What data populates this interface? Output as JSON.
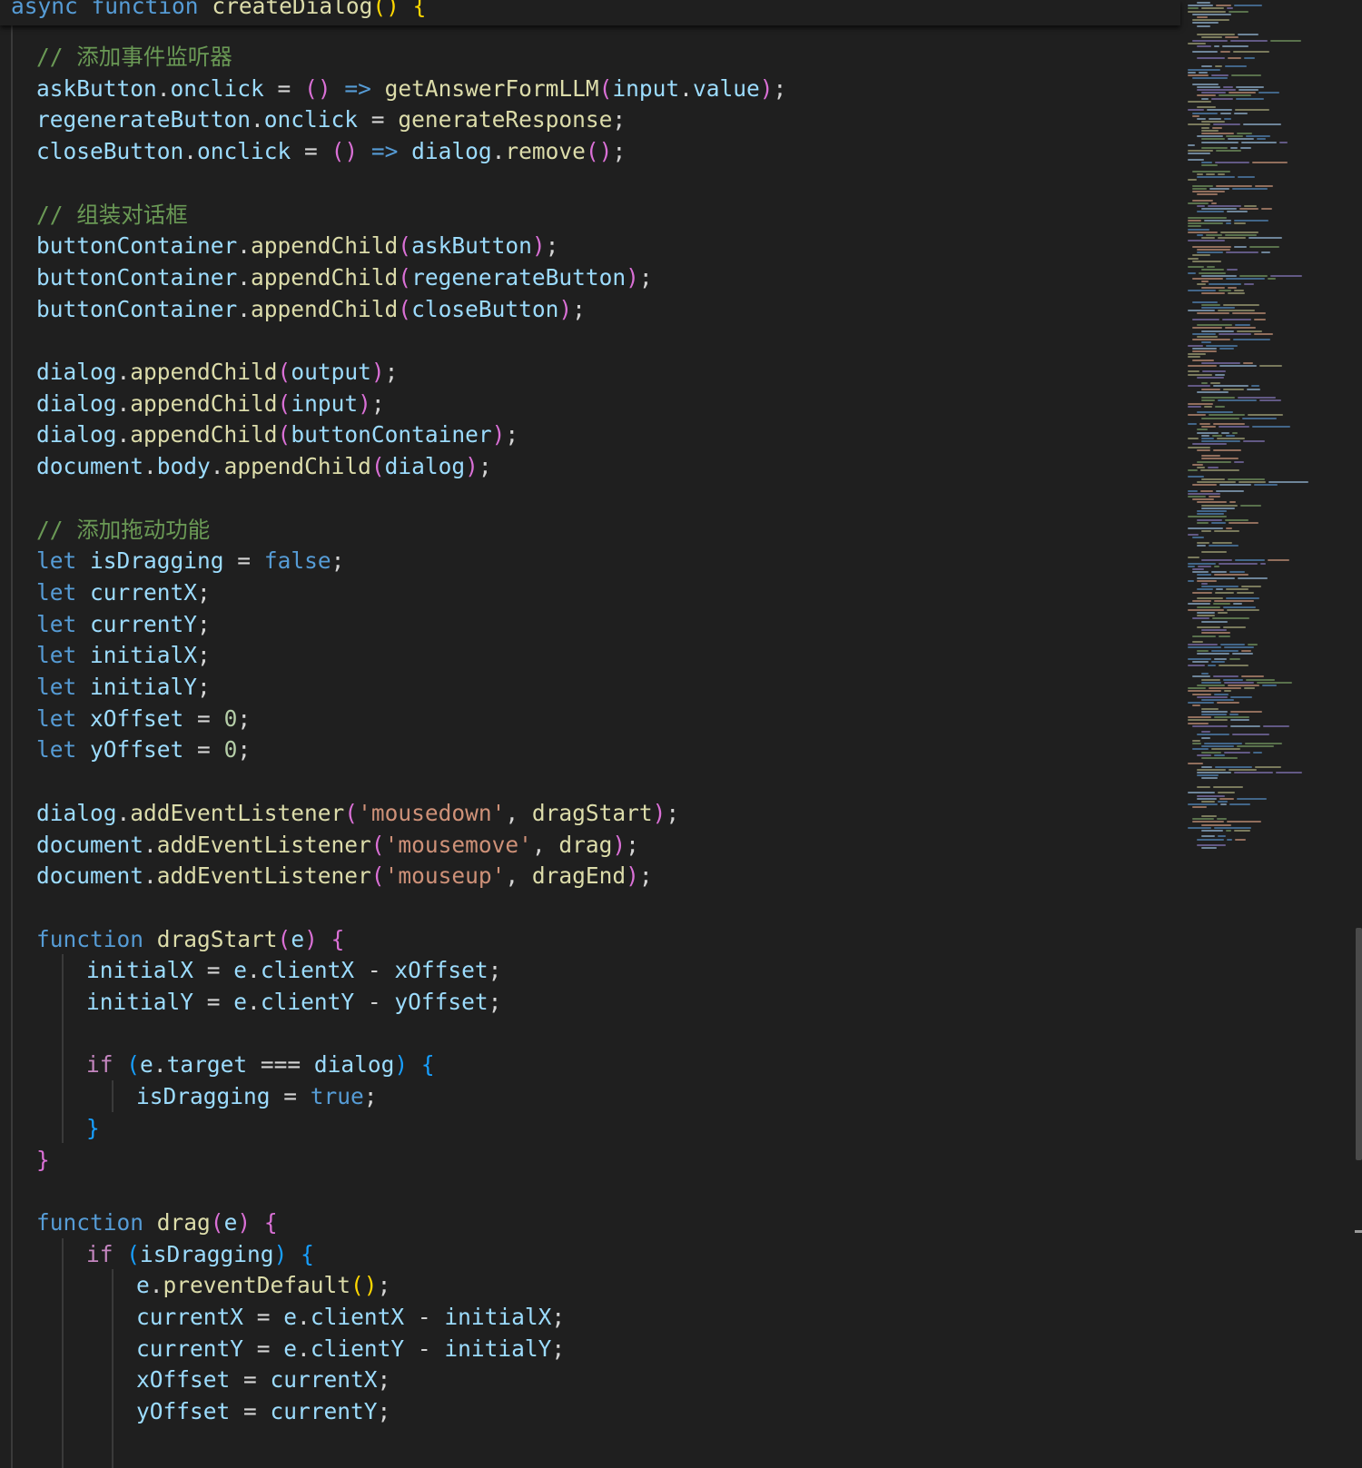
{
  "sticky_scroll": {
    "tokens": [
      {
        "t": "async",
        "c": "kw"
      },
      {
        "t": " ",
        "c": "op"
      },
      {
        "t": "function",
        "c": "kw"
      },
      {
        "t": " ",
        "c": "op"
      },
      {
        "t": "createDialog",
        "c": "fn"
      },
      {
        "t": "()",
        "c": "b1"
      },
      {
        "t": " ",
        "c": "op"
      },
      {
        "t": "{",
        "c": "b1"
      }
    ]
  },
  "code_lines": [
    {
      "tokens": [
        {
          "t": "// 添加事件监听器",
          "c": "cmt"
        }
      ]
    },
    {
      "tokens": [
        {
          "t": "askButton",
          "c": "var"
        },
        {
          "t": ".",
          "c": "pun"
        },
        {
          "t": "onclick",
          "c": "var"
        },
        {
          "t": " = ",
          "c": "op"
        },
        {
          "t": "()",
          "c": "b2"
        },
        {
          "t": " ",
          "c": "op"
        },
        {
          "t": "=>",
          "c": "kw"
        },
        {
          "t": " ",
          "c": "op"
        },
        {
          "t": "getAnswerFormLLM",
          "c": "fn"
        },
        {
          "t": "(",
          "c": "b2"
        },
        {
          "t": "input",
          "c": "var"
        },
        {
          "t": ".",
          "c": "pun"
        },
        {
          "t": "value",
          "c": "var"
        },
        {
          "t": ")",
          "c": "b2"
        },
        {
          "t": ";",
          "c": "pun"
        }
      ]
    },
    {
      "tokens": [
        {
          "t": "regenerateButton",
          "c": "var"
        },
        {
          "t": ".",
          "c": "pun"
        },
        {
          "t": "onclick",
          "c": "var"
        },
        {
          "t": " = ",
          "c": "op"
        },
        {
          "t": "generateResponse",
          "c": "fn"
        },
        {
          "t": ";",
          "c": "pun"
        }
      ]
    },
    {
      "tokens": [
        {
          "t": "closeButton",
          "c": "var"
        },
        {
          "t": ".",
          "c": "pun"
        },
        {
          "t": "onclick",
          "c": "var"
        },
        {
          "t": " = ",
          "c": "op"
        },
        {
          "t": "()",
          "c": "b2"
        },
        {
          "t": " ",
          "c": "op"
        },
        {
          "t": "=>",
          "c": "kw"
        },
        {
          "t": " ",
          "c": "op"
        },
        {
          "t": "dialog",
          "c": "var"
        },
        {
          "t": ".",
          "c": "pun"
        },
        {
          "t": "remove",
          "c": "fn"
        },
        {
          "t": "()",
          "c": "b2"
        },
        {
          "t": ";",
          "c": "pun"
        }
      ]
    },
    {
      "tokens": []
    },
    {
      "tokens": [
        {
          "t": "// 组装对话框",
          "c": "cmt"
        }
      ]
    },
    {
      "tokens": [
        {
          "t": "buttonContainer",
          "c": "var"
        },
        {
          "t": ".",
          "c": "pun"
        },
        {
          "t": "appendChild",
          "c": "fn"
        },
        {
          "t": "(",
          "c": "b2"
        },
        {
          "t": "askButton",
          "c": "var"
        },
        {
          "t": ")",
          "c": "b2"
        },
        {
          "t": ";",
          "c": "pun"
        }
      ]
    },
    {
      "tokens": [
        {
          "t": "buttonContainer",
          "c": "var"
        },
        {
          "t": ".",
          "c": "pun"
        },
        {
          "t": "appendChild",
          "c": "fn"
        },
        {
          "t": "(",
          "c": "b2"
        },
        {
          "t": "regenerateButton",
          "c": "var"
        },
        {
          "t": ")",
          "c": "b2"
        },
        {
          "t": ";",
          "c": "pun"
        }
      ]
    },
    {
      "tokens": [
        {
          "t": "buttonContainer",
          "c": "var"
        },
        {
          "t": ".",
          "c": "pun"
        },
        {
          "t": "appendChild",
          "c": "fn"
        },
        {
          "t": "(",
          "c": "b2"
        },
        {
          "t": "closeButton",
          "c": "var"
        },
        {
          "t": ")",
          "c": "b2"
        },
        {
          "t": ";",
          "c": "pun"
        }
      ]
    },
    {
      "tokens": []
    },
    {
      "tokens": [
        {
          "t": "dialog",
          "c": "var"
        },
        {
          "t": ".",
          "c": "pun"
        },
        {
          "t": "appendChild",
          "c": "fn"
        },
        {
          "t": "(",
          "c": "b2"
        },
        {
          "t": "output",
          "c": "var"
        },
        {
          "t": ")",
          "c": "b2"
        },
        {
          "t": ";",
          "c": "pun"
        }
      ]
    },
    {
      "tokens": [
        {
          "t": "dialog",
          "c": "var"
        },
        {
          "t": ".",
          "c": "pun"
        },
        {
          "t": "appendChild",
          "c": "fn"
        },
        {
          "t": "(",
          "c": "b2"
        },
        {
          "t": "input",
          "c": "var"
        },
        {
          "t": ")",
          "c": "b2"
        },
        {
          "t": ";",
          "c": "pun"
        }
      ]
    },
    {
      "tokens": [
        {
          "t": "dialog",
          "c": "var"
        },
        {
          "t": ".",
          "c": "pun"
        },
        {
          "t": "appendChild",
          "c": "fn"
        },
        {
          "t": "(",
          "c": "b2"
        },
        {
          "t": "buttonContainer",
          "c": "var"
        },
        {
          "t": ")",
          "c": "b2"
        },
        {
          "t": ";",
          "c": "pun"
        }
      ]
    },
    {
      "tokens": [
        {
          "t": "document",
          "c": "var"
        },
        {
          "t": ".",
          "c": "pun"
        },
        {
          "t": "body",
          "c": "var"
        },
        {
          "t": ".",
          "c": "pun"
        },
        {
          "t": "appendChild",
          "c": "fn"
        },
        {
          "t": "(",
          "c": "b2"
        },
        {
          "t": "dialog",
          "c": "var"
        },
        {
          "t": ")",
          "c": "b2"
        },
        {
          "t": ";",
          "c": "pun"
        }
      ]
    },
    {
      "tokens": []
    },
    {
      "tokens": [
        {
          "t": "// 添加拖动功能",
          "c": "cmt"
        }
      ]
    },
    {
      "tokens": [
        {
          "t": "let",
          "c": "kw"
        },
        {
          "t": " ",
          "c": "op"
        },
        {
          "t": "isDragging",
          "c": "var"
        },
        {
          "t": " = ",
          "c": "op"
        },
        {
          "t": "false",
          "c": "kw"
        },
        {
          "t": ";",
          "c": "pun"
        }
      ]
    },
    {
      "tokens": [
        {
          "t": "let",
          "c": "kw"
        },
        {
          "t": " ",
          "c": "op"
        },
        {
          "t": "currentX",
          "c": "var"
        },
        {
          "t": ";",
          "c": "pun"
        }
      ]
    },
    {
      "tokens": [
        {
          "t": "let",
          "c": "kw"
        },
        {
          "t": " ",
          "c": "op"
        },
        {
          "t": "currentY",
          "c": "var"
        },
        {
          "t": ";",
          "c": "pun"
        }
      ]
    },
    {
      "tokens": [
        {
          "t": "let",
          "c": "kw"
        },
        {
          "t": " ",
          "c": "op"
        },
        {
          "t": "initialX",
          "c": "var"
        },
        {
          "t": ";",
          "c": "pun"
        }
      ]
    },
    {
      "tokens": [
        {
          "t": "let",
          "c": "kw"
        },
        {
          "t": " ",
          "c": "op"
        },
        {
          "t": "initialY",
          "c": "var"
        },
        {
          "t": ";",
          "c": "pun"
        }
      ]
    },
    {
      "tokens": [
        {
          "t": "let",
          "c": "kw"
        },
        {
          "t": " ",
          "c": "op"
        },
        {
          "t": "xOffset",
          "c": "var"
        },
        {
          "t": " = ",
          "c": "op"
        },
        {
          "t": "0",
          "c": "num"
        },
        {
          "t": ";",
          "c": "pun"
        }
      ]
    },
    {
      "tokens": [
        {
          "t": "let",
          "c": "kw"
        },
        {
          "t": " ",
          "c": "op"
        },
        {
          "t": "yOffset",
          "c": "var"
        },
        {
          "t": " = ",
          "c": "op"
        },
        {
          "t": "0",
          "c": "num"
        },
        {
          "t": ";",
          "c": "pun"
        }
      ]
    },
    {
      "tokens": []
    },
    {
      "tokens": [
        {
          "t": "dialog",
          "c": "var"
        },
        {
          "t": ".",
          "c": "pun"
        },
        {
          "t": "addEventListener",
          "c": "fn"
        },
        {
          "t": "(",
          "c": "b2"
        },
        {
          "t": "'mousedown'",
          "c": "str"
        },
        {
          "t": ", ",
          "c": "pun"
        },
        {
          "t": "dragStart",
          "c": "fn"
        },
        {
          "t": ")",
          "c": "b2"
        },
        {
          "t": ";",
          "c": "pun"
        }
      ]
    },
    {
      "tokens": [
        {
          "t": "document",
          "c": "var"
        },
        {
          "t": ".",
          "c": "pun"
        },
        {
          "t": "addEventListener",
          "c": "fn"
        },
        {
          "t": "(",
          "c": "b2"
        },
        {
          "t": "'mousemove'",
          "c": "str"
        },
        {
          "t": ", ",
          "c": "pun"
        },
        {
          "t": "drag",
          "c": "fn"
        },
        {
          "t": ")",
          "c": "b2"
        },
        {
          "t": ";",
          "c": "pun"
        }
      ]
    },
    {
      "tokens": [
        {
          "t": "document",
          "c": "var"
        },
        {
          "t": ".",
          "c": "pun"
        },
        {
          "t": "addEventListener",
          "c": "fn"
        },
        {
          "t": "(",
          "c": "b2"
        },
        {
          "t": "'mouseup'",
          "c": "str"
        },
        {
          "t": ", ",
          "c": "pun"
        },
        {
          "t": "dragEnd",
          "c": "fn"
        },
        {
          "t": ")",
          "c": "b2"
        },
        {
          "t": ";",
          "c": "pun"
        }
      ]
    },
    {
      "tokens": []
    },
    {
      "tokens": [
        {
          "t": "function",
          "c": "kw"
        },
        {
          "t": " ",
          "c": "op"
        },
        {
          "t": "dragStart",
          "c": "fn"
        },
        {
          "t": "(",
          "c": "b2"
        },
        {
          "t": "e",
          "c": "var"
        },
        {
          "t": ")",
          "c": "b2"
        },
        {
          "t": " ",
          "c": "op"
        },
        {
          "t": "{",
          "c": "b2"
        }
      ]
    },
    {
      "indent": 1,
      "tokens": [
        {
          "t": "initialX",
          "c": "var"
        },
        {
          "t": " = ",
          "c": "op"
        },
        {
          "t": "e",
          "c": "var"
        },
        {
          "t": ".",
          "c": "pun"
        },
        {
          "t": "clientX",
          "c": "var"
        },
        {
          "t": " - ",
          "c": "op"
        },
        {
          "t": "xOffset",
          "c": "var"
        },
        {
          "t": ";",
          "c": "pun"
        }
      ]
    },
    {
      "indent": 1,
      "tokens": [
        {
          "t": "initialY",
          "c": "var"
        },
        {
          "t": " = ",
          "c": "op"
        },
        {
          "t": "e",
          "c": "var"
        },
        {
          "t": ".",
          "c": "pun"
        },
        {
          "t": "clientY",
          "c": "var"
        },
        {
          "t": " - ",
          "c": "op"
        },
        {
          "t": "yOffset",
          "c": "var"
        },
        {
          "t": ";",
          "c": "pun"
        }
      ]
    },
    {
      "indent": 1,
      "tokens": []
    },
    {
      "indent": 1,
      "tokens": [
        {
          "t": "if",
          "c": "ctrl"
        },
        {
          "t": " ",
          "c": "op"
        },
        {
          "t": "(",
          "c": "b3"
        },
        {
          "t": "e",
          "c": "var"
        },
        {
          "t": ".",
          "c": "pun"
        },
        {
          "t": "target",
          "c": "var"
        },
        {
          "t": " === ",
          "c": "op"
        },
        {
          "t": "dialog",
          "c": "var"
        },
        {
          "t": ")",
          "c": "b3"
        },
        {
          "t": " ",
          "c": "op"
        },
        {
          "t": "{",
          "c": "b3"
        }
      ]
    },
    {
      "indent": 2,
      "tokens": [
        {
          "t": "isDragging",
          "c": "var"
        },
        {
          "t": " = ",
          "c": "op"
        },
        {
          "t": "true",
          "c": "kw"
        },
        {
          "t": ";",
          "c": "pun"
        }
      ]
    },
    {
      "indent": 1,
      "tokens": [
        {
          "t": "}",
          "c": "b3"
        }
      ]
    },
    {
      "tokens": [
        {
          "t": "}",
          "c": "b2"
        }
      ]
    },
    {
      "tokens": []
    },
    {
      "tokens": [
        {
          "t": "function",
          "c": "kw"
        },
        {
          "t": " ",
          "c": "op"
        },
        {
          "t": "drag",
          "c": "fn"
        },
        {
          "t": "(",
          "c": "b2"
        },
        {
          "t": "e",
          "c": "var"
        },
        {
          "t": ")",
          "c": "b2"
        },
        {
          "t": " ",
          "c": "op"
        },
        {
          "t": "{",
          "c": "b2"
        }
      ]
    },
    {
      "indent": 1,
      "tokens": [
        {
          "t": "if",
          "c": "ctrl"
        },
        {
          "t": " ",
          "c": "op"
        },
        {
          "t": "(",
          "c": "b3"
        },
        {
          "t": "isDragging",
          "c": "var"
        },
        {
          "t": ")",
          "c": "b3"
        },
        {
          "t": " ",
          "c": "op"
        },
        {
          "t": "{",
          "c": "b3"
        }
      ]
    },
    {
      "indent": 2,
      "tokens": [
        {
          "t": "e",
          "c": "var"
        },
        {
          "t": ".",
          "c": "pun"
        },
        {
          "t": "preventDefault",
          "c": "fn"
        },
        {
          "t": "()",
          "c": "b1"
        },
        {
          "t": ";",
          "c": "pun"
        }
      ]
    },
    {
      "indent": 2,
      "tokens": [
        {
          "t": "currentX",
          "c": "var"
        },
        {
          "t": " = ",
          "c": "op"
        },
        {
          "t": "e",
          "c": "var"
        },
        {
          "t": ".",
          "c": "pun"
        },
        {
          "t": "clientX",
          "c": "var"
        },
        {
          "t": " - ",
          "c": "op"
        },
        {
          "t": "initialX",
          "c": "var"
        },
        {
          "t": ";",
          "c": "pun"
        }
      ]
    },
    {
      "indent": 2,
      "tokens": [
        {
          "t": "currentY",
          "c": "var"
        },
        {
          "t": " = ",
          "c": "op"
        },
        {
          "t": "e",
          "c": "var"
        },
        {
          "t": ".",
          "c": "pun"
        },
        {
          "t": "clientY",
          "c": "var"
        },
        {
          "t": " - ",
          "c": "op"
        },
        {
          "t": "initialY",
          "c": "var"
        },
        {
          "t": ";",
          "c": "pun"
        }
      ]
    },
    {
      "indent": 2,
      "tokens": [
        {
          "t": "xOffset",
          "c": "var"
        },
        {
          "t": " = ",
          "c": "op"
        },
        {
          "t": "currentX",
          "c": "var"
        },
        {
          "t": ";",
          "c": "pun"
        }
      ]
    },
    {
      "indent": 2,
      "tokens": [
        {
          "t": "yOffset",
          "c": "var"
        },
        {
          "t": " = ",
          "c": "op"
        },
        {
          "t": "currentY",
          "c": "var"
        },
        {
          "t": ";",
          "c": "pun"
        }
      ]
    }
  ]
}
